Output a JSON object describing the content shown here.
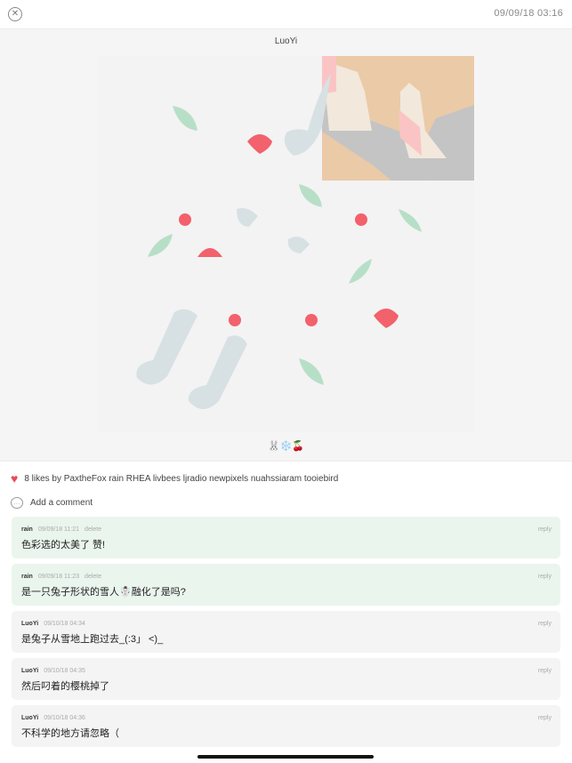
{
  "header": {
    "close_icon": "close-circle-icon",
    "timestamp": "09/09/18 03:16"
  },
  "post": {
    "author": "LuoYi",
    "caption": "🐰❄️🍒",
    "colors": {
      "leaf": "#b7dfc8",
      "berry": "#f2616c",
      "snow": "#d7e1e4",
      "skin": "#ebcaa7",
      "grey": "#c4c4c4",
      "pink": "#fbc4c4",
      "cream": "#f2e8dc",
      "background": "#f5f5f5"
    }
  },
  "likes": {
    "icon": "heart-icon",
    "text": "8 likes by PaxtheFox rain RHEA livbees ljradio newpixels nuahssiaram tooiebird"
  },
  "add_comment": {
    "icon": "comment-bubble-icon",
    "label": "Add a comment"
  },
  "comments": [
    {
      "user": "rain",
      "time": "09/09/18 11:21",
      "delete_label": "delete",
      "reply_label": "reply",
      "text": "色彩选的太美了 赞!",
      "mine": true
    },
    {
      "user": "rain",
      "time": "09/09/18 11:23",
      "delete_label": "delete",
      "reply_label": "reply",
      "text": "是一只兔子形状的雪人☃️融化了是吗?",
      "mine": true
    },
    {
      "user": "LuoYi",
      "time": "09/10/18 04:34",
      "reply_label": "reply",
      "text": "是兔子从雪地上跑过去_(:3」 <)_",
      "mine": false
    },
    {
      "user": "LuoYi",
      "time": "09/10/18 04:35",
      "reply_label": "reply",
      "text": "然后叼着的樱桃掉了",
      "mine": false
    },
    {
      "user": "LuoYi",
      "time": "09/10/18 04:36",
      "reply_label": "reply",
      "text": "不科学的地方请忽略（",
      "mine": false
    }
  ]
}
